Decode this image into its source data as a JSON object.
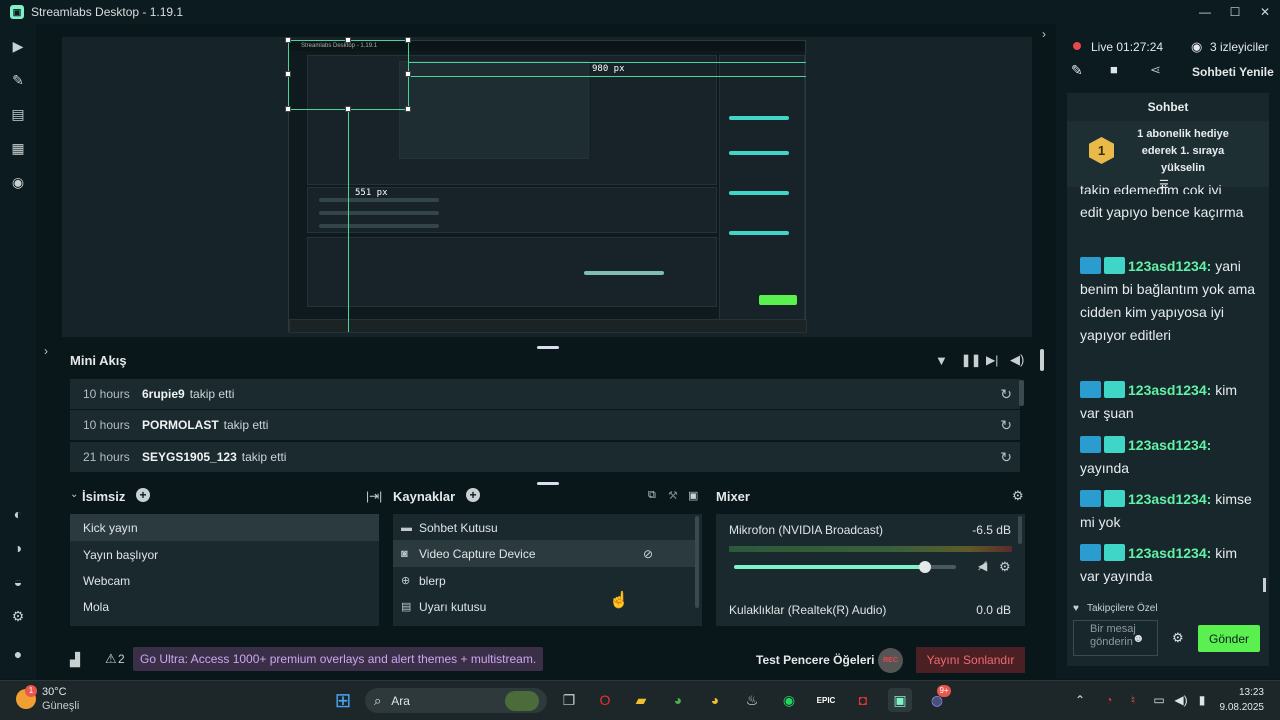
{
  "window": {
    "title": "Streamlabs Desktop - 1.19.1"
  },
  "preview": {
    "width_readout": "980 px",
    "height_readout": "551 px"
  },
  "mini_feed": {
    "title": "Mini Akış",
    "rows": [
      {
        "time": "10 hours",
        "name": "6rupie9",
        "action": "takip etti"
      },
      {
        "time": "10 hours",
        "name": "PORMOLAST",
        "action": "takip etti"
      },
      {
        "time": "21 hours",
        "name": "SEYGS1905_123",
        "action": "takip etti"
      }
    ]
  },
  "scenes": {
    "title": "İsimsiz",
    "items": [
      "Kick yayın",
      "Yayın başlıyor",
      "Webcam",
      "Mola"
    ]
  },
  "sources": {
    "title": "Kaynaklar",
    "items": [
      "Sohbet Kutusu",
      "Video Capture Device",
      "blerp",
      "Uyarı kutusu"
    ]
  },
  "mixer": {
    "title": "Mixer",
    "channels": [
      {
        "name": "Mikrofon (NVIDIA Broadcast)",
        "db": "-6.5 dB",
        "volume": 0.86
      },
      {
        "name": "Kulaklıklar (Realtek(R) Audio)",
        "db": "0.0 dB"
      }
    ]
  },
  "footer": {
    "alerts_count": "2",
    "promo": "Go Ultra: Access 1000+ premium overlays and alert themes + multistream.",
    "test_widgets": "Test Pencere Öğeleri",
    "rec": "REC",
    "end_stream": "Yayını Sonlandır"
  },
  "live": {
    "status": "Live 01:27:24",
    "viewers": "3 izleyiciler",
    "refresh_chat": "Sohbeti Yenile"
  },
  "chat": {
    "title": "Sohbet",
    "pinned": "1 abonelik hediye ederek 1. sıraya yükselin",
    "pinned_rank": "1",
    "partial_top": "takip edemedim çok iyi",
    "messages": [
      {
        "text": "edit yapıyo bence kaçırma"
      },
      {
        "user": "123asd1234",
        "text": "yani benim bi bağlantım yok ama cidden kim yapıyosa iyi yapıyor editleri"
      },
      {
        "user": "123asd1234",
        "text": "kim var şuan"
      },
      {
        "user": "123asd1234",
        "text": "yayında"
      },
      {
        "user": "123asd1234",
        "text": "kimse mi yok"
      },
      {
        "user": "123asd1234",
        "text": "kim var yayında"
      }
    ],
    "followers_only": "Takipçilere Özel",
    "input_placeholder": "Bir mesaj gönderin",
    "send": "Gönder"
  },
  "taskbar": {
    "weather_temp": "30°C",
    "weather_desc": "Güneşli",
    "weather_badge": "1",
    "search": "Ara",
    "clock_time": "13:23",
    "clock_date": "9.08.2025",
    "discord_badge": "9+"
  },
  "colors": {
    "accent": "#7ff2c8",
    "chat_user": "#62f2a7",
    "send": "#5af04f",
    "live_dot": "#e5484d"
  }
}
